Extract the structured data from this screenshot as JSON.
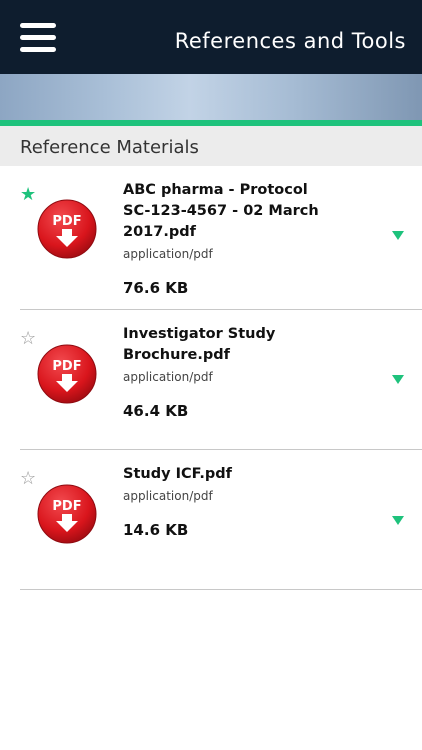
{
  "header": {
    "title": "References and Tools"
  },
  "section": {
    "title": "Reference Materials"
  },
  "colors": {
    "topbar": "#0e1d2e",
    "accent": "#1ec27c",
    "pdf_red": "#d9151c"
  },
  "icons": {
    "menu": "hamburger-menu-icon",
    "pdf": "pdf-download-icon",
    "favorite_filled": "star-filled-icon",
    "favorite_empty": "star-outline-icon",
    "expand": "chevron-down-icon"
  },
  "pdf_badge": "PDF",
  "files": [
    {
      "name_line1": "ABC pharma - Protocol",
      "name_line2": "SC-123-4567 - 02 March 2017.pdf",
      "type": "application/pdf",
      "size": "76.6 KB",
      "favorite": true
    },
    {
      "name_line1": "Investigator Study Brochure.pdf",
      "name_line2": "",
      "type": "application/pdf",
      "size": "46.4 KB",
      "favorite": false
    },
    {
      "name_line1": "Study ICF.pdf",
      "name_line2": "",
      "type": "application/pdf",
      "size": "14.6 KB",
      "favorite": false
    }
  ]
}
